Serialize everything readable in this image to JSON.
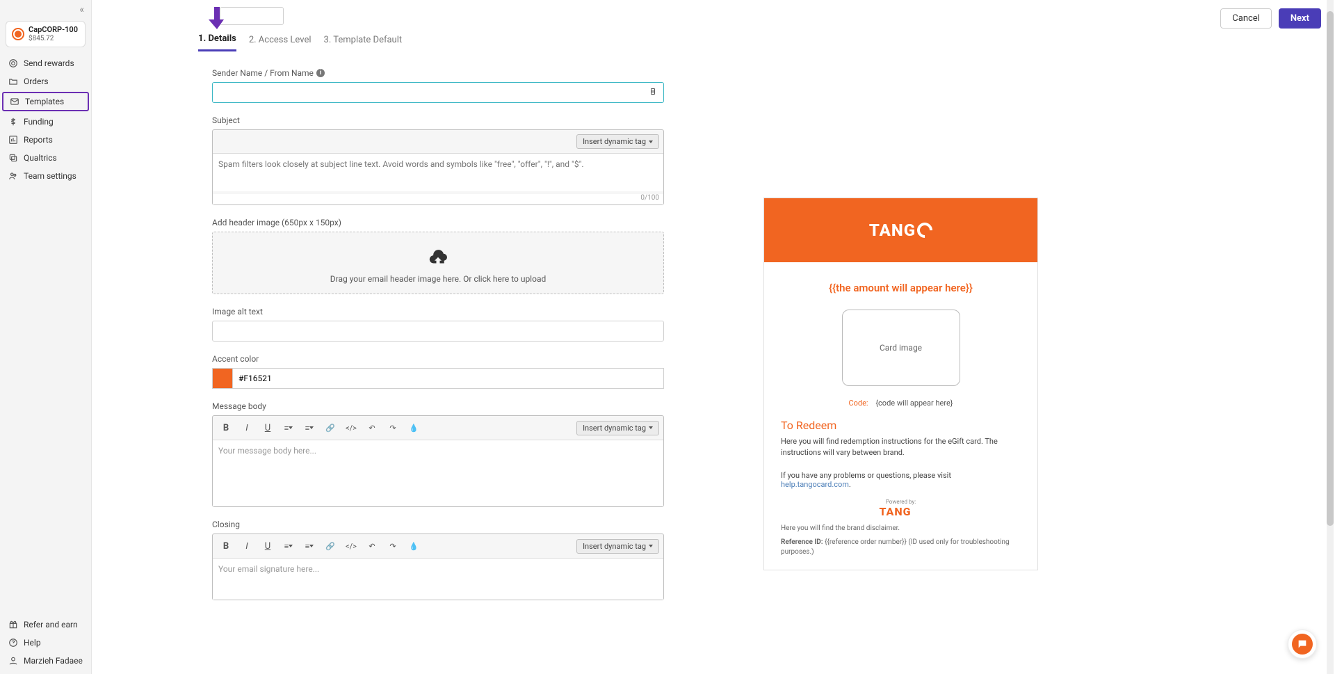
{
  "account": {
    "name": "CapCORP-100",
    "balance": "$845.72"
  },
  "sidebar": {
    "items": [
      {
        "label": "Send rewards"
      },
      {
        "label": "Orders"
      },
      {
        "label": "Templates"
      },
      {
        "label": "Funding"
      },
      {
        "label": "Reports"
      },
      {
        "label": "Qualtrics"
      },
      {
        "label": "Team settings"
      }
    ],
    "footer": [
      {
        "label": "Refer and earn"
      },
      {
        "label": "Help"
      },
      {
        "label": "Marzieh Fadaee"
      }
    ]
  },
  "actions": {
    "cancel": "Cancel",
    "next": "Next"
  },
  "steps": {
    "s1": "1.  Details",
    "s2": "2.  Access Level",
    "s3": "3.  Template Default"
  },
  "form": {
    "sender_label": "Sender Name / From Name",
    "subject_label": "Subject",
    "insert_tag": "Insert dynamic tag",
    "subject_placeholder": "Spam filters look closely at subject line text. Avoid words and symbols like \"free\", \"offer\", \"!\", and \"$\".",
    "subject_counter": "0/100",
    "header_label": "Add header image (650px x 150px)",
    "upload_hint": "Drag your email header image here. Or click here to upload",
    "alt_label": "Image alt text",
    "accent_label": "Accent color",
    "accent_value": "#F16521",
    "body_label": "Message body",
    "body_placeholder": "Your message body here...",
    "closing_label": "Closing",
    "closing_placeholder": "Your email signature here..."
  },
  "preview": {
    "logo": "TANG",
    "amount": "{{the amount will appear here}}",
    "card_image": "Card image",
    "code_label": "Code:",
    "code_value": "{code will appear here}",
    "redeem_title": "To Redeem",
    "redeem_text": "Here you will find redemption instructions for the eGift card. The instructions will vary between brand.",
    "problems_prefix": "If you have any problems or questions, please visit ",
    "help_link": "help.tangocard.com",
    "powered_by": "Powered by:",
    "tango_small": "TANG",
    "disclaimer": "Here you will find the brand disclaimer.",
    "ref_label": "Reference ID: ",
    "ref_value": "{{reference order number}}",
    "ref_note": " (ID used only for troubleshooting purposes.)"
  }
}
